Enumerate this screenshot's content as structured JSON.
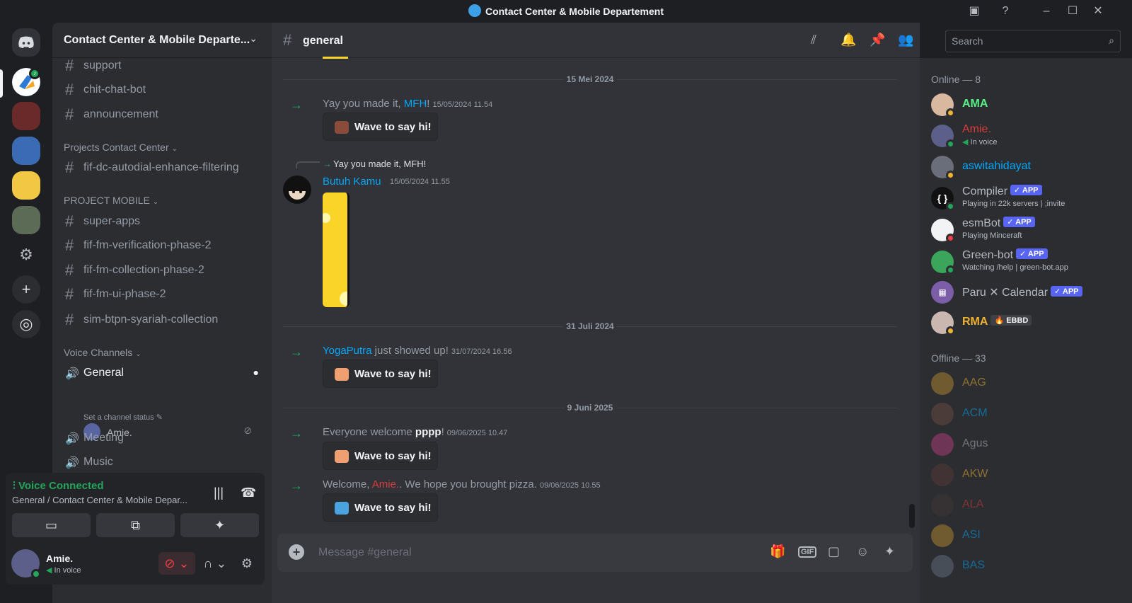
{
  "window": {
    "title": "Contact Center & Mobile Departement"
  },
  "server": {
    "name": "Contact Center & Mobile Departe..."
  },
  "channels": {
    "top": [
      {
        "label": "support"
      },
      {
        "label": "chit-chat-bot"
      },
      {
        "label": "announcement"
      }
    ],
    "categories": [
      {
        "label": "Projects Contact Center"
      },
      {
        "label": "PROJECT MOBILE"
      },
      {
        "label": "Voice Channels"
      }
    ],
    "projects_cc": [
      {
        "label": "fif-dc-autodial-enhance-filtering"
      }
    ],
    "project_mobile": [
      {
        "label": "super-apps"
      },
      {
        "label": "fif-fm-verification-phase-2"
      },
      {
        "label": "fif-fm-collection-phase-2"
      },
      {
        "label": "fif-fm-ui-phase-2"
      },
      {
        "label": "sim-btpn-syariah-collection"
      }
    ],
    "voice": [
      {
        "label": "General"
      },
      {
        "label": "Meeting"
      },
      {
        "label": "Music"
      }
    ],
    "voice_status_placeholder": "Set a channel status",
    "voice_user": "Amie."
  },
  "voice_panel": {
    "title": "Voice Connected",
    "subtitle": "General / Contact Center & Mobile Depar..."
  },
  "user": {
    "name": "Amie.",
    "status": "In voice"
  },
  "chat": {
    "channel": "general",
    "search_placeholder": "Search",
    "composer_placeholder": "Message #general",
    "wave_label": "Wave to say hi!",
    "dates": [
      "15 Mei 2024",
      "31 Juli 2024",
      "9 Juni 2025"
    ],
    "messages": [
      {
        "pre": "Yay you made it, ",
        "user": "MFH",
        "post": "!",
        "ts": "15/05/2024 11.54"
      },
      {
        "pre": "",
        "user": "YogaPutra",
        "post": " just showed up!",
        "ts": "31/07/2024 16.56"
      },
      {
        "pre": "Everyone welcome ",
        "user": "pppp",
        "post": "!",
        "ts": "09/06/2025 10.47"
      },
      {
        "pre": "Welcome, ",
        "user": "Amie.",
        "post": ". We hope you brought pizza.",
        "ts": "09/06/2025 10.55"
      }
    ],
    "reply": {
      "quoted": "Yay you made it, MFH!",
      "author": "Butuh Kamu",
      "ts": "15/05/2024 11.55"
    }
  },
  "members": {
    "online_header": "Online — 8",
    "offline_header": "Offline — 33",
    "app_tag": "APP",
    "online": [
      {
        "name": "AMA",
        "color": "#57f287",
        "sub": "",
        "status": "idle"
      },
      {
        "name": "Amie.",
        "color": "#d83c3e",
        "sub": "In voice",
        "status": "online"
      },
      {
        "name": "aswitahidayat",
        "color": "#00a8fc",
        "sub": "",
        "status": "idle"
      },
      {
        "name": "Compiler",
        "color": "#b5bac1",
        "sub": "Playing in 22k servers | ;invite",
        "status": "online",
        "app": true
      },
      {
        "name": "esmBot",
        "color": "#b5bac1",
        "sub": "Playing Minceraft",
        "status": "dnd",
        "app": true
      },
      {
        "name": "Green-bot",
        "color": "#b5bac1",
        "sub": "Watching /help | green-bot.app",
        "status": "online",
        "app": true
      },
      {
        "name": "Paru ✕ Calendar",
        "color": "#b5bac1",
        "sub": "",
        "status": "none",
        "app": true
      },
      {
        "name": "RMA",
        "color": "#f0b232",
        "sub": "",
        "status": "idle",
        "tag": "EBBD"
      }
    ],
    "offline": [
      {
        "name": "AAG",
        "color": "#f0b232"
      },
      {
        "name": "ACM",
        "color": "#00a8fc"
      },
      {
        "name": "Agus",
        "color": "#b5bac1"
      },
      {
        "name": "AKW",
        "color": "#f0b232"
      },
      {
        "name": "ALA",
        "color": "#d83c3e"
      },
      {
        "name": "ASI",
        "color": "#00a8fc"
      },
      {
        "name": "BAS",
        "color": "#00a8fc"
      }
    ]
  }
}
